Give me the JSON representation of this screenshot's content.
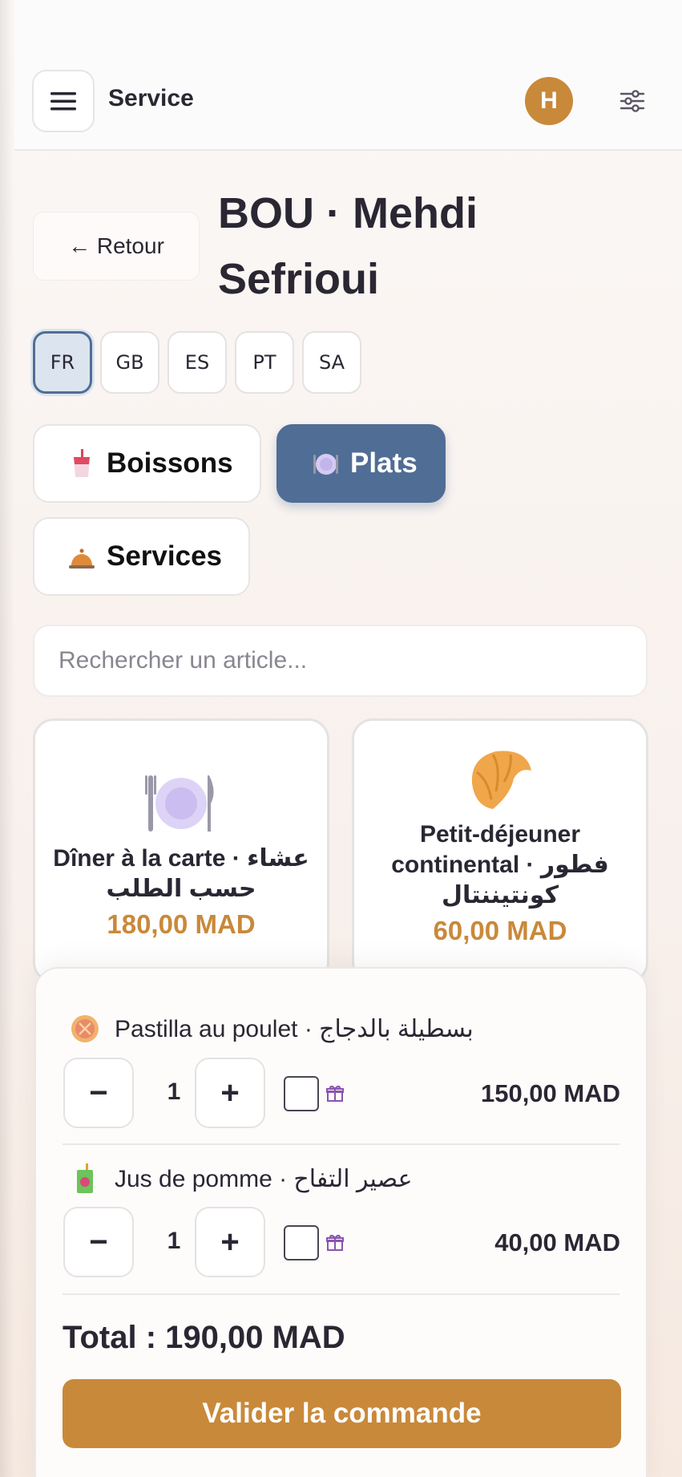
{
  "header": {
    "app_title": "Service",
    "avatar_initial": "H",
    "menu_icon": "hamburger-icon",
    "filter_icon": "sliders-icon"
  },
  "guest": {
    "back_label": "← Retour",
    "title": "BOU · Mehdi Sefrioui"
  },
  "languages": [
    {
      "code": "FR",
      "active": true
    },
    {
      "code": "GB",
      "active": false
    },
    {
      "code": "ES",
      "active": false
    },
    {
      "code": "PT",
      "active": false
    },
    {
      "code": "SA",
      "active": false
    }
  ],
  "categories": [
    {
      "label": "Boissons",
      "icon": "drink-cup-icon",
      "active": false
    },
    {
      "label": "Plats",
      "icon": "plate-icon",
      "active": true
    },
    {
      "label": "Services",
      "icon": "service-bell-icon",
      "active": false
    }
  ],
  "search": {
    "placeholder": "Rechercher un article..."
  },
  "products": [
    {
      "name": "Dîner à la carte · عشاء حسب الطلب",
      "price": "180,00 MAD",
      "icon": "plate-cutlery-icon"
    },
    {
      "name": "Petit-déjeuner continental · فطور كونتيننتال",
      "price": "60,00 MAD",
      "icon": "croissant-icon"
    }
  ],
  "cart": {
    "lines": [
      {
        "name": "Pastilla au poulet · بسطيلة بالدجاج",
        "qty": "1",
        "price": "150,00 MAD",
        "icon": "pastilla-icon",
        "gift": false
      },
      {
        "name": "Jus de pomme · عصير التفاح",
        "qty": "1",
        "price": "40,00 MAD",
        "icon": "juice-box-icon",
        "gift": false
      }
    ],
    "minus": "−",
    "plus": "+",
    "total": "Total : 190,00 MAD",
    "validate_label": "Valider la commande"
  },
  "colors": {
    "accent": "#c9893a",
    "primary": "#506d95"
  }
}
